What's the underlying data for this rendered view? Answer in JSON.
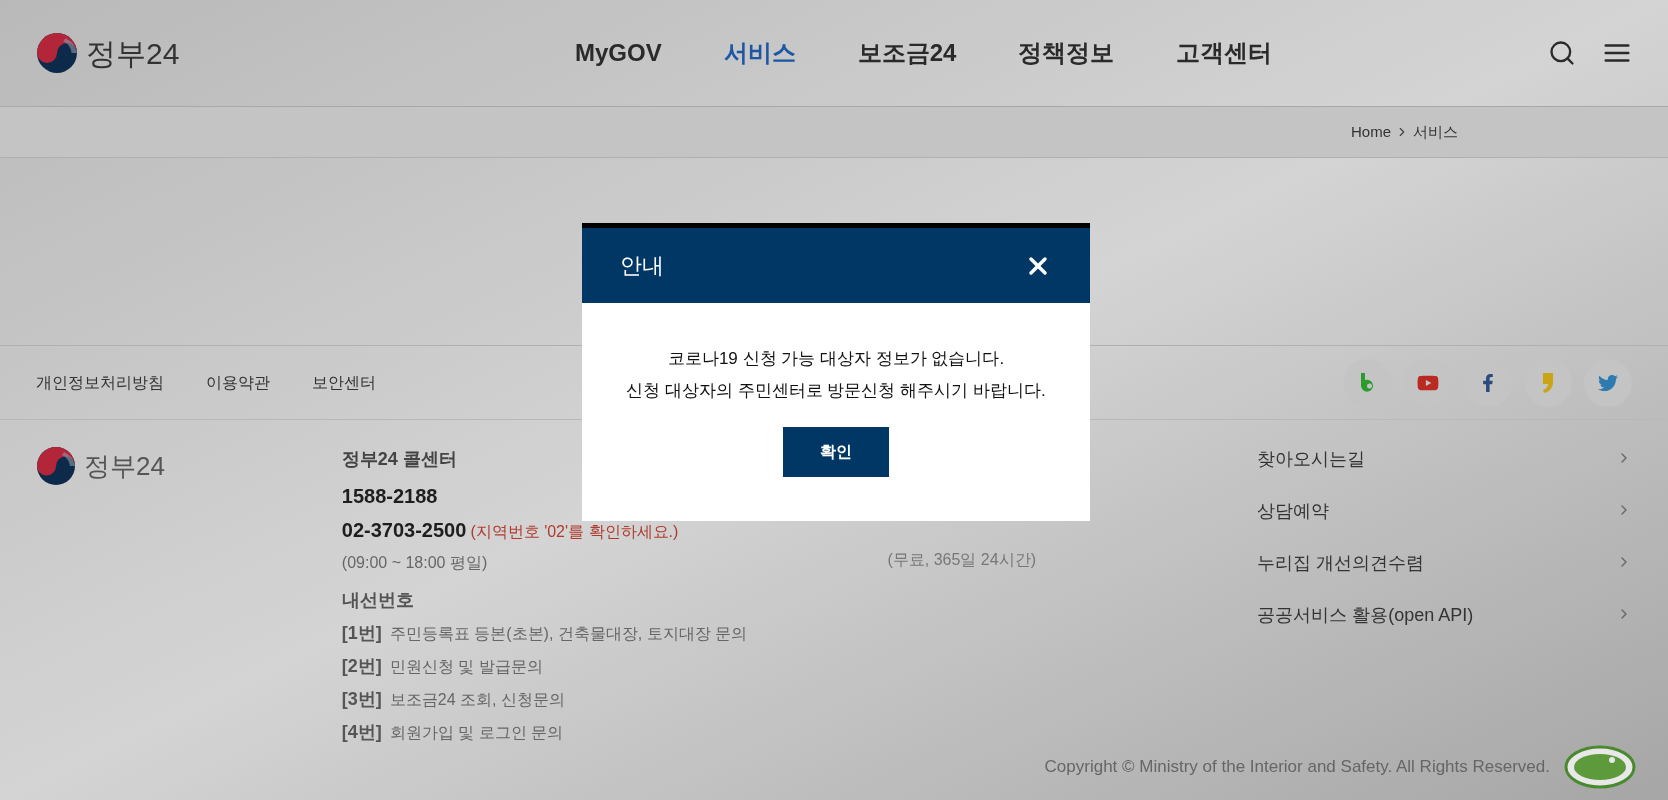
{
  "header": {
    "logo_text": "정부24",
    "nav": [
      {
        "label": "MyGOV",
        "selected": false
      },
      {
        "label": "서비스",
        "selected": true
      },
      {
        "label": "보조금24",
        "selected": false
      },
      {
        "label": "정책정보",
        "selected": false
      },
      {
        "label": "고객센터",
        "selected": false
      }
    ]
  },
  "breadcrumb": {
    "items": [
      "Home",
      "서비스"
    ]
  },
  "footer": {
    "links": [
      "개인정보처리방침",
      "이용약관",
      "보안센터"
    ],
    "social": [
      {
        "kind": "band"
      },
      {
        "kind": "youtube"
      },
      {
        "kind": "facebook"
      },
      {
        "kind": "story"
      },
      {
        "kind": "twitter"
      }
    ],
    "logo_text": "정부24",
    "call_center": {
      "title": "정부24 콜센터",
      "phone": "1588-2188",
      "phone2": "02-3703-2500",
      "phone2_note": "(지역번호 '02'를 확인하세요.)",
      "hours": "(09:00 ~ 18:00 평일)"
    },
    "extensions_title": "내선번호",
    "extensions": [
      {
        "num": "[1번]",
        "text": "주민등록표 등본(초본), 건축물대장, 토지대장 문의"
      },
      {
        "num": "[2번]",
        "text": "민원신청 및 발급문의"
      },
      {
        "num": "[3번]",
        "text": "보조금24 조회, 신청문의"
      },
      {
        "num": "[4번]",
        "text": "회원가입 및 로그인 문의"
      }
    ],
    "other_hours": "(무료, 365일 24시간)",
    "quick_links": [
      "찾아오시는길",
      "상담예약",
      "누리집 개선의견수렴",
      "공공서비스 활용(open API)"
    ],
    "copyright": "Copyright © Ministry of the Interior and Safety. All Rights Reserved."
  },
  "modal": {
    "title": "안내",
    "message": [
      "코로나19 신청 가능 대상자 정보가 없습니다.",
      "신청 대상자의 주민센터로 방문신청 해주시기 바랍니다."
    ],
    "confirm": "확인"
  }
}
